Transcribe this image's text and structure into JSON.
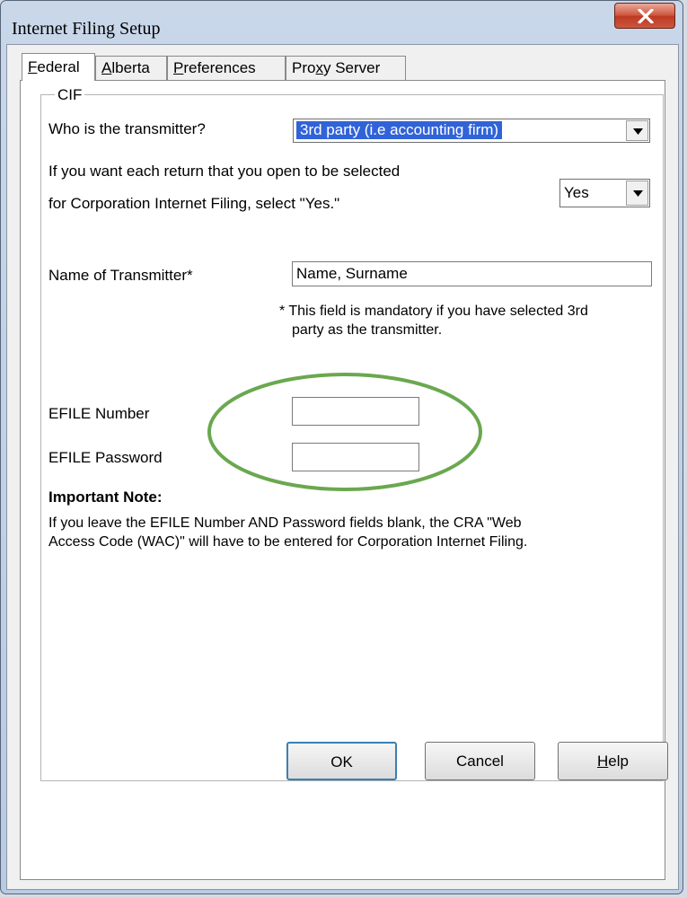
{
  "window": {
    "title": "Internet Filing Setup",
    "close_icon": "close-icon"
  },
  "tabs": [
    {
      "label": "Federal",
      "accesskey": "F",
      "rest": "ederal",
      "active": true
    },
    {
      "label": "Alberta",
      "accesskey": "A",
      "rest": "lberta",
      "active": false
    },
    {
      "label": "Preferences",
      "accesskey": "P",
      "rest": "references",
      "active": false
    },
    {
      "label": "Proxy Server",
      "prefix": "Pro",
      "accesskey": "x",
      "rest": "y Server",
      "active": false
    }
  ],
  "cif": {
    "group_label": "CIF",
    "transmitter_label": "Who is the transmitter?",
    "transmitter_value": "3rd party (i.e accounting firm)",
    "select_line1": "If you want each return that you open to be selected",
    "select_line2": "for Corporation Internet Filing, select \"Yes.\"",
    "select_value": "Yes",
    "name_label": "Name of Transmitter*",
    "name_value": "Name, Surname",
    "mandatory_line1": "* This field is mandatory if you have selected 3rd",
    "mandatory_line2": "party as the transmitter.",
    "efile_number_label": "EFILE Number",
    "efile_number_value": "",
    "efile_password_label": "EFILE Password",
    "efile_password_value": "",
    "important_heading": "Important Note:",
    "important_line1": "If you leave the EFILE Number AND Password fields blank, the CRA \"Web",
    "important_line2": "Access Code (WAC)\" will have to be entered for Corporation Internet Filing."
  },
  "buttons": {
    "ok": "OK",
    "cancel": "Cancel",
    "help_accesskey": "H",
    "help_rest": "elp"
  },
  "colors": {
    "selection": "#3163d8",
    "highlight_ellipse": "#6aa84f"
  }
}
